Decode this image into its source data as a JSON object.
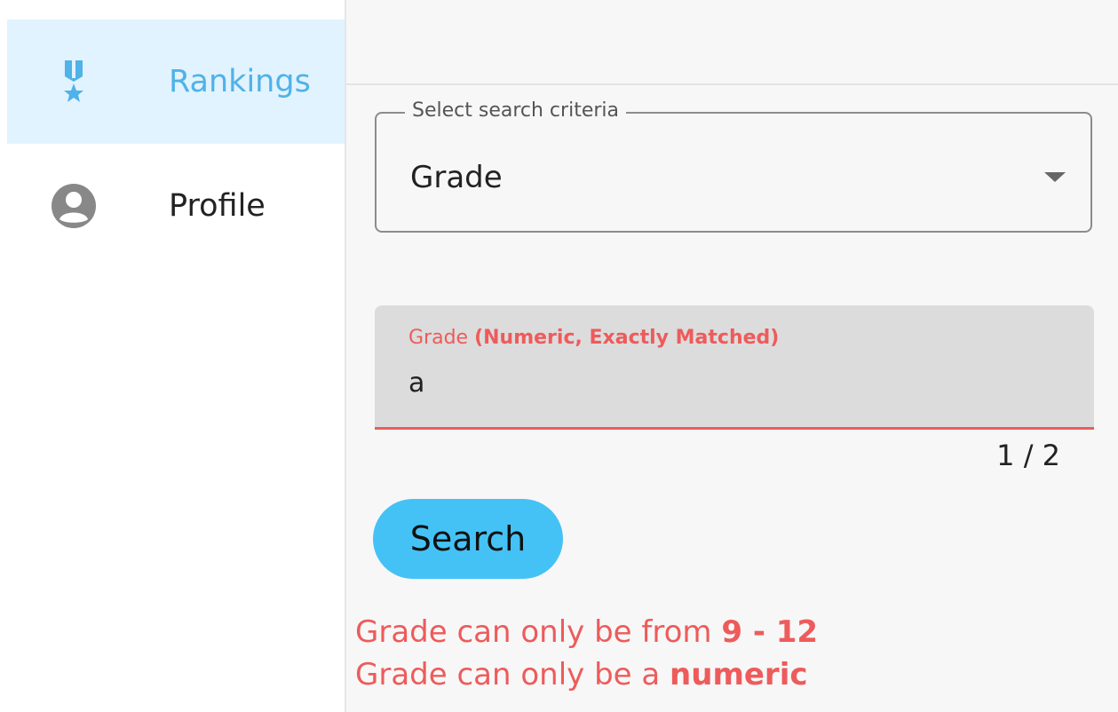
{
  "sidebar": {
    "items": [
      {
        "label": "Rankings",
        "icon": "medal-icon",
        "active": true
      },
      {
        "label": "Profile",
        "icon": "account-icon",
        "active": false
      }
    ]
  },
  "search_form": {
    "criteria_label": "Select search criteria",
    "criteria_value": "Grade",
    "grade_label": "Grade",
    "grade_hint": "(Numeric, Exactly Matched)",
    "grade_value": "a",
    "char_counter": "1 / 2",
    "search_button": "Search"
  },
  "errors": [
    {
      "text": "Grade can only be from ",
      "emphasis": "9 - 12"
    },
    {
      "text": "Grade can only be a ",
      "emphasis": "numeric"
    }
  ],
  "colors": {
    "active_nav_bg": "#e1f3fe",
    "active_nav_text": "#4fb2e8",
    "button": "#45c2f5",
    "error": "#ee5b5b"
  }
}
